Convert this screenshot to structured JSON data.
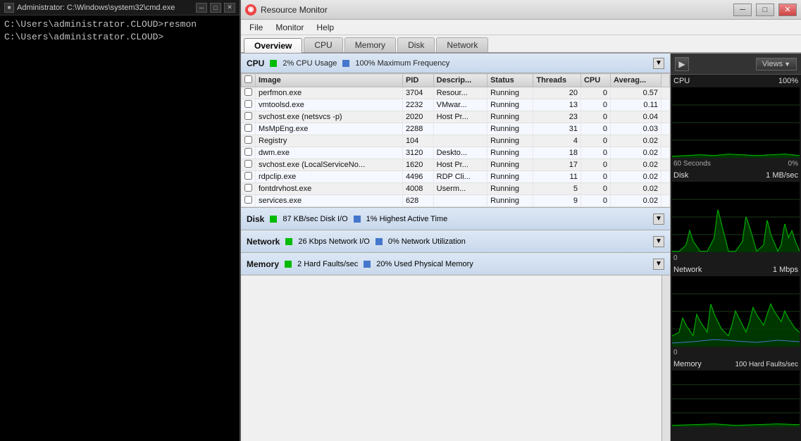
{
  "cmd": {
    "title": "Administrator: C:\\Windows\\system32\\cmd.exe",
    "icon": "■",
    "lines": [
      "C:\\Users\\administrator.CLOUD>resmon",
      "C:\\Users\\administrator.CLOUD>"
    ],
    "win_btns": [
      "─",
      "□",
      "✕"
    ]
  },
  "resmon": {
    "title": "Resource Monitor",
    "icon": "◉",
    "win_btns": [
      "─",
      "□",
      "✕"
    ],
    "menu": [
      "File",
      "Monitor",
      "Help"
    ],
    "tabs": [
      "Overview",
      "CPU",
      "Memory",
      "Disk",
      "Network"
    ],
    "active_tab": "Overview"
  },
  "cpu_section": {
    "title": "CPU",
    "stat1_label": "2% CPU Usage",
    "stat2_label": "100% Maximum Frequency",
    "columns": [
      "",
      "Image",
      "PID",
      "Descrip...",
      "Status",
      "Threads",
      "CPU",
      "Averag..."
    ],
    "rows": [
      {
        "image": "perfmon.exe",
        "pid": "3704",
        "desc": "Resour...",
        "status": "Running",
        "threads": "20",
        "cpu": "0",
        "avg": "0.57"
      },
      {
        "image": "vmtoolsd.exe",
        "pid": "2232",
        "desc": "VMwar...",
        "status": "Running",
        "threads": "13",
        "cpu": "0",
        "avg": "0.11"
      },
      {
        "image": "svchost.exe (netsvcs -p)",
        "pid": "2020",
        "desc": "Host Pr...",
        "status": "Running",
        "threads": "23",
        "cpu": "0",
        "avg": "0.04"
      },
      {
        "image": "MsMpEng.exe",
        "pid": "2288",
        "desc": "",
        "status": "Running",
        "threads": "31",
        "cpu": "0",
        "avg": "0.03"
      },
      {
        "image": "Registry",
        "pid": "104",
        "desc": "",
        "status": "Running",
        "threads": "4",
        "cpu": "0",
        "avg": "0.02"
      },
      {
        "image": "dwm.exe",
        "pid": "3120",
        "desc": "Deskto...",
        "status": "Running",
        "threads": "18",
        "cpu": "0",
        "avg": "0.02"
      },
      {
        "image": "svchost.exe (LocalServiceNo...",
        "pid": "1620",
        "desc": "Host Pr...",
        "status": "Running",
        "threads": "17",
        "cpu": "0",
        "avg": "0.02"
      },
      {
        "image": "rdpclip.exe",
        "pid": "4496",
        "desc": "RDP Cli...",
        "status": "Running",
        "threads": "11",
        "cpu": "0",
        "avg": "0.02"
      },
      {
        "image": "fontdrvhost.exe",
        "pid": "4008",
        "desc": "Userm...",
        "status": "Running",
        "threads": "5",
        "cpu": "0",
        "avg": "0.02"
      },
      {
        "image": "services.exe",
        "pid": "628",
        "desc": "",
        "status": "Running",
        "threads": "9",
        "cpu": "0",
        "avg": "0.02"
      }
    ]
  },
  "disk_section": {
    "title": "Disk",
    "stat1_label": "87 KB/sec Disk I/O",
    "stat2_label": "1% Highest Active Time"
  },
  "network_section": {
    "title": "Network",
    "stat1_label": "26 Kbps Network I/O",
    "stat2_label": "0% Network Utilization"
  },
  "memory_section": {
    "title": "Memory",
    "stat1_label": "2 Hard Faults/sec",
    "stat2_label": "20% Used Physical Memory"
  },
  "right_panel": {
    "nav_arrow": "▶",
    "views_label": "Views",
    "drop_arrow": "▼",
    "graphs": [
      {
        "label": "CPU",
        "value": "100%",
        "time": "60 Seconds",
        "pct": "0%"
      },
      {
        "label": "Disk",
        "value": "1 MB/sec",
        "time": "",
        "pct": "0"
      },
      {
        "label": "Network",
        "value": "1 Mbps",
        "time": "",
        "pct": "0"
      },
      {
        "label": "Memory",
        "value": "100 Hard Faults/sec",
        "time": "",
        "pct": ""
      }
    ]
  }
}
